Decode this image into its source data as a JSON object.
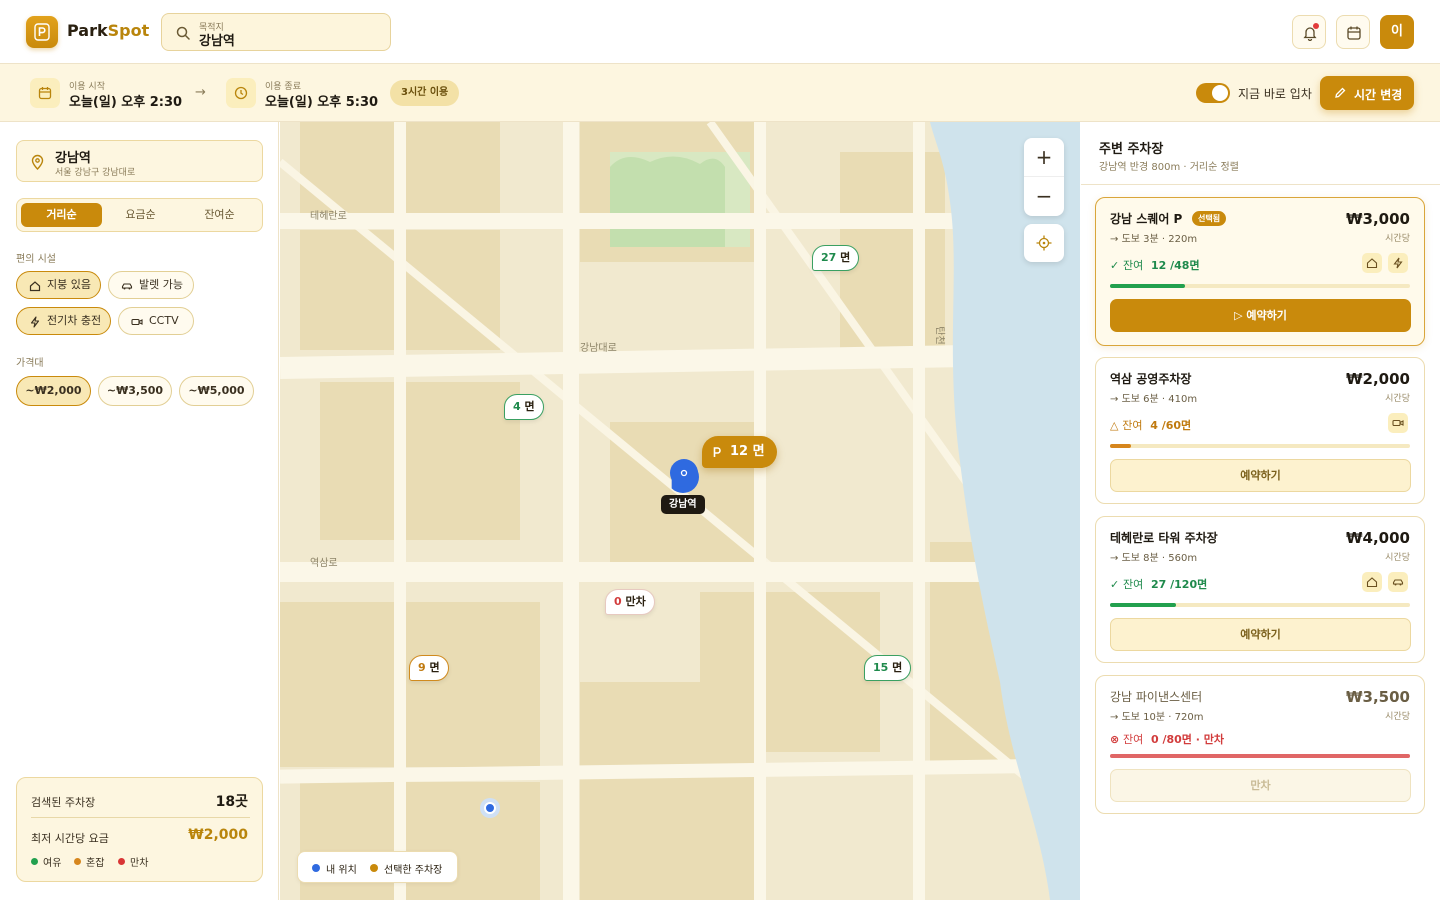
{
  "header": {
    "brand_a": "Park",
    "brand_b": "Spot",
    "search_label": "목적지",
    "search_value": "강남역",
    "avatar": "이"
  },
  "timebar": {
    "start_label": "이용 시작",
    "start_value": "오늘(일) 오후 2:30",
    "end_label": "이용 종료",
    "end_value": "오늘(일) 오후 5:30",
    "duration": "3시간 이용",
    "instant_label": "지금 바로 입차",
    "instant_on": true,
    "change_label": "시간 변경"
  },
  "left": {
    "location_name": "강남역",
    "location_addr": "서울 강남구 강남대로",
    "sort": [
      "거리순",
      "요금순",
      "잔여순"
    ],
    "sort_active": 0,
    "facilities_title": "편의 시설",
    "facilities": [
      {
        "label": "지붕 있음",
        "icon": "roof-icon",
        "active": true
      },
      {
        "label": "발렛 가능",
        "icon": "car-icon",
        "active": false
      },
      {
        "label": "전기차 충전",
        "icon": "bolt-icon",
        "active": true
      },
      {
        "label": "CCTV",
        "icon": "camera-icon",
        "active": false
      }
    ],
    "price_title": "가격대",
    "prices": [
      {
        "label": "~₩2,000",
        "active": true
      },
      {
        "label": "~₩3,500",
        "active": false
      },
      {
        "label": "~₩5,000",
        "active": false
      }
    ],
    "summary": {
      "count_label": "검색된 주차장",
      "count_value": "18곳",
      "min_label": "최저 시간당 요금",
      "min_value": "₩2,000",
      "legend": [
        "여유",
        "혼잡",
        "만차"
      ]
    }
  },
  "map": {
    "roads": [
      "테헤란로",
      "강남대로",
      "역삼로",
      "탄천"
    ],
    "badges": [
      {
        "num": "27",
        "unit": "면",
        "status": "green"
      },
      {
        "num": "4",
        "unit": "면",
        "status": "green"
      },
      {
        "num": "0",
        "unit": "만차",
        "status": "red"
      },
      {
        "num": "9",
        "unit": "면",
        "status": "orange"
      },
      {
        "num": "15",
        "unit": "면",
        "status": "green"
      }
    ],
    "selected_badge": "12 면",
    "pin_label": "강남역",
    "legend_my": "내 위치",
    "legend_selected": "선택한 주차장",
    "colors": {
      "my": "#2f6ae0",
      "selected": "#c98a0c",
      "good": "#22a04e",
      "busy": "#d6861d",
      "full": "#d93535"
    }
  },
  "right": {
    "title": "주변 주차장",
    "subtitle": "강남역 반경 800m · 거리순 정렬",
    "lots": [
      {
        "name": "강남 스퀘어 P",
        "tag": "선택됨",
        "walk": "도보 3분 · 220m",
        "price": "₩3,000",
        "unit": "시간당",
        "avail_pre": "잔여",
        "avail_num": "12",
        "avail_total": "/48면",
        "status": "good",
        "ratio": 0.25,
        "button": "예약하기",
        "icons": [
          "roof-icon",
          "bolt-icon"
        ]
      },
      {
        "name": "역삼 공영주차장",
        "tag": "",
        "walk": "도보 6분 · 410m",
        "price": "₩2,000",
        "unit": "시간당",
        "avail_pre": "잔여",
        "avail_num": "4",
        "avail_total": "/60면",
        "status": "busy",
        "ratio": 0.07,
        "button": "예약하기",
        "icons": [
          "camera-icon"
        ]
      },
      {
        "name": "테헤란로 타워 주차장",
        "tag": "",
        "walk": "도보 8분 · 560m",
        "price": "₩4,000",
        "unit": "시간당",
        "avail_pre": "잔여",
        "avail_num": "27",
        "avail_total": "/120면",
        "status": "good",
        "ratio": 0.22,
        "button": "예약하기",
        "icons": [
          "roof-icon",
          "car-icon"
        ]
      },
      {
        "name": "강남 파이낸스센터",
        "tag": "",
        "walk": "도보 10분 · 720m",
        "price": "₩3,500",
        "unit": "시간당",
        "avail_pre": "잔여",
        "avail_num": "0",
        "avail_total": "/80면 · 만차",
        "status": "full",
        "ratio": 1.0,
        "button": "만차",
        "icons": []
      }
    ]
  }
}
